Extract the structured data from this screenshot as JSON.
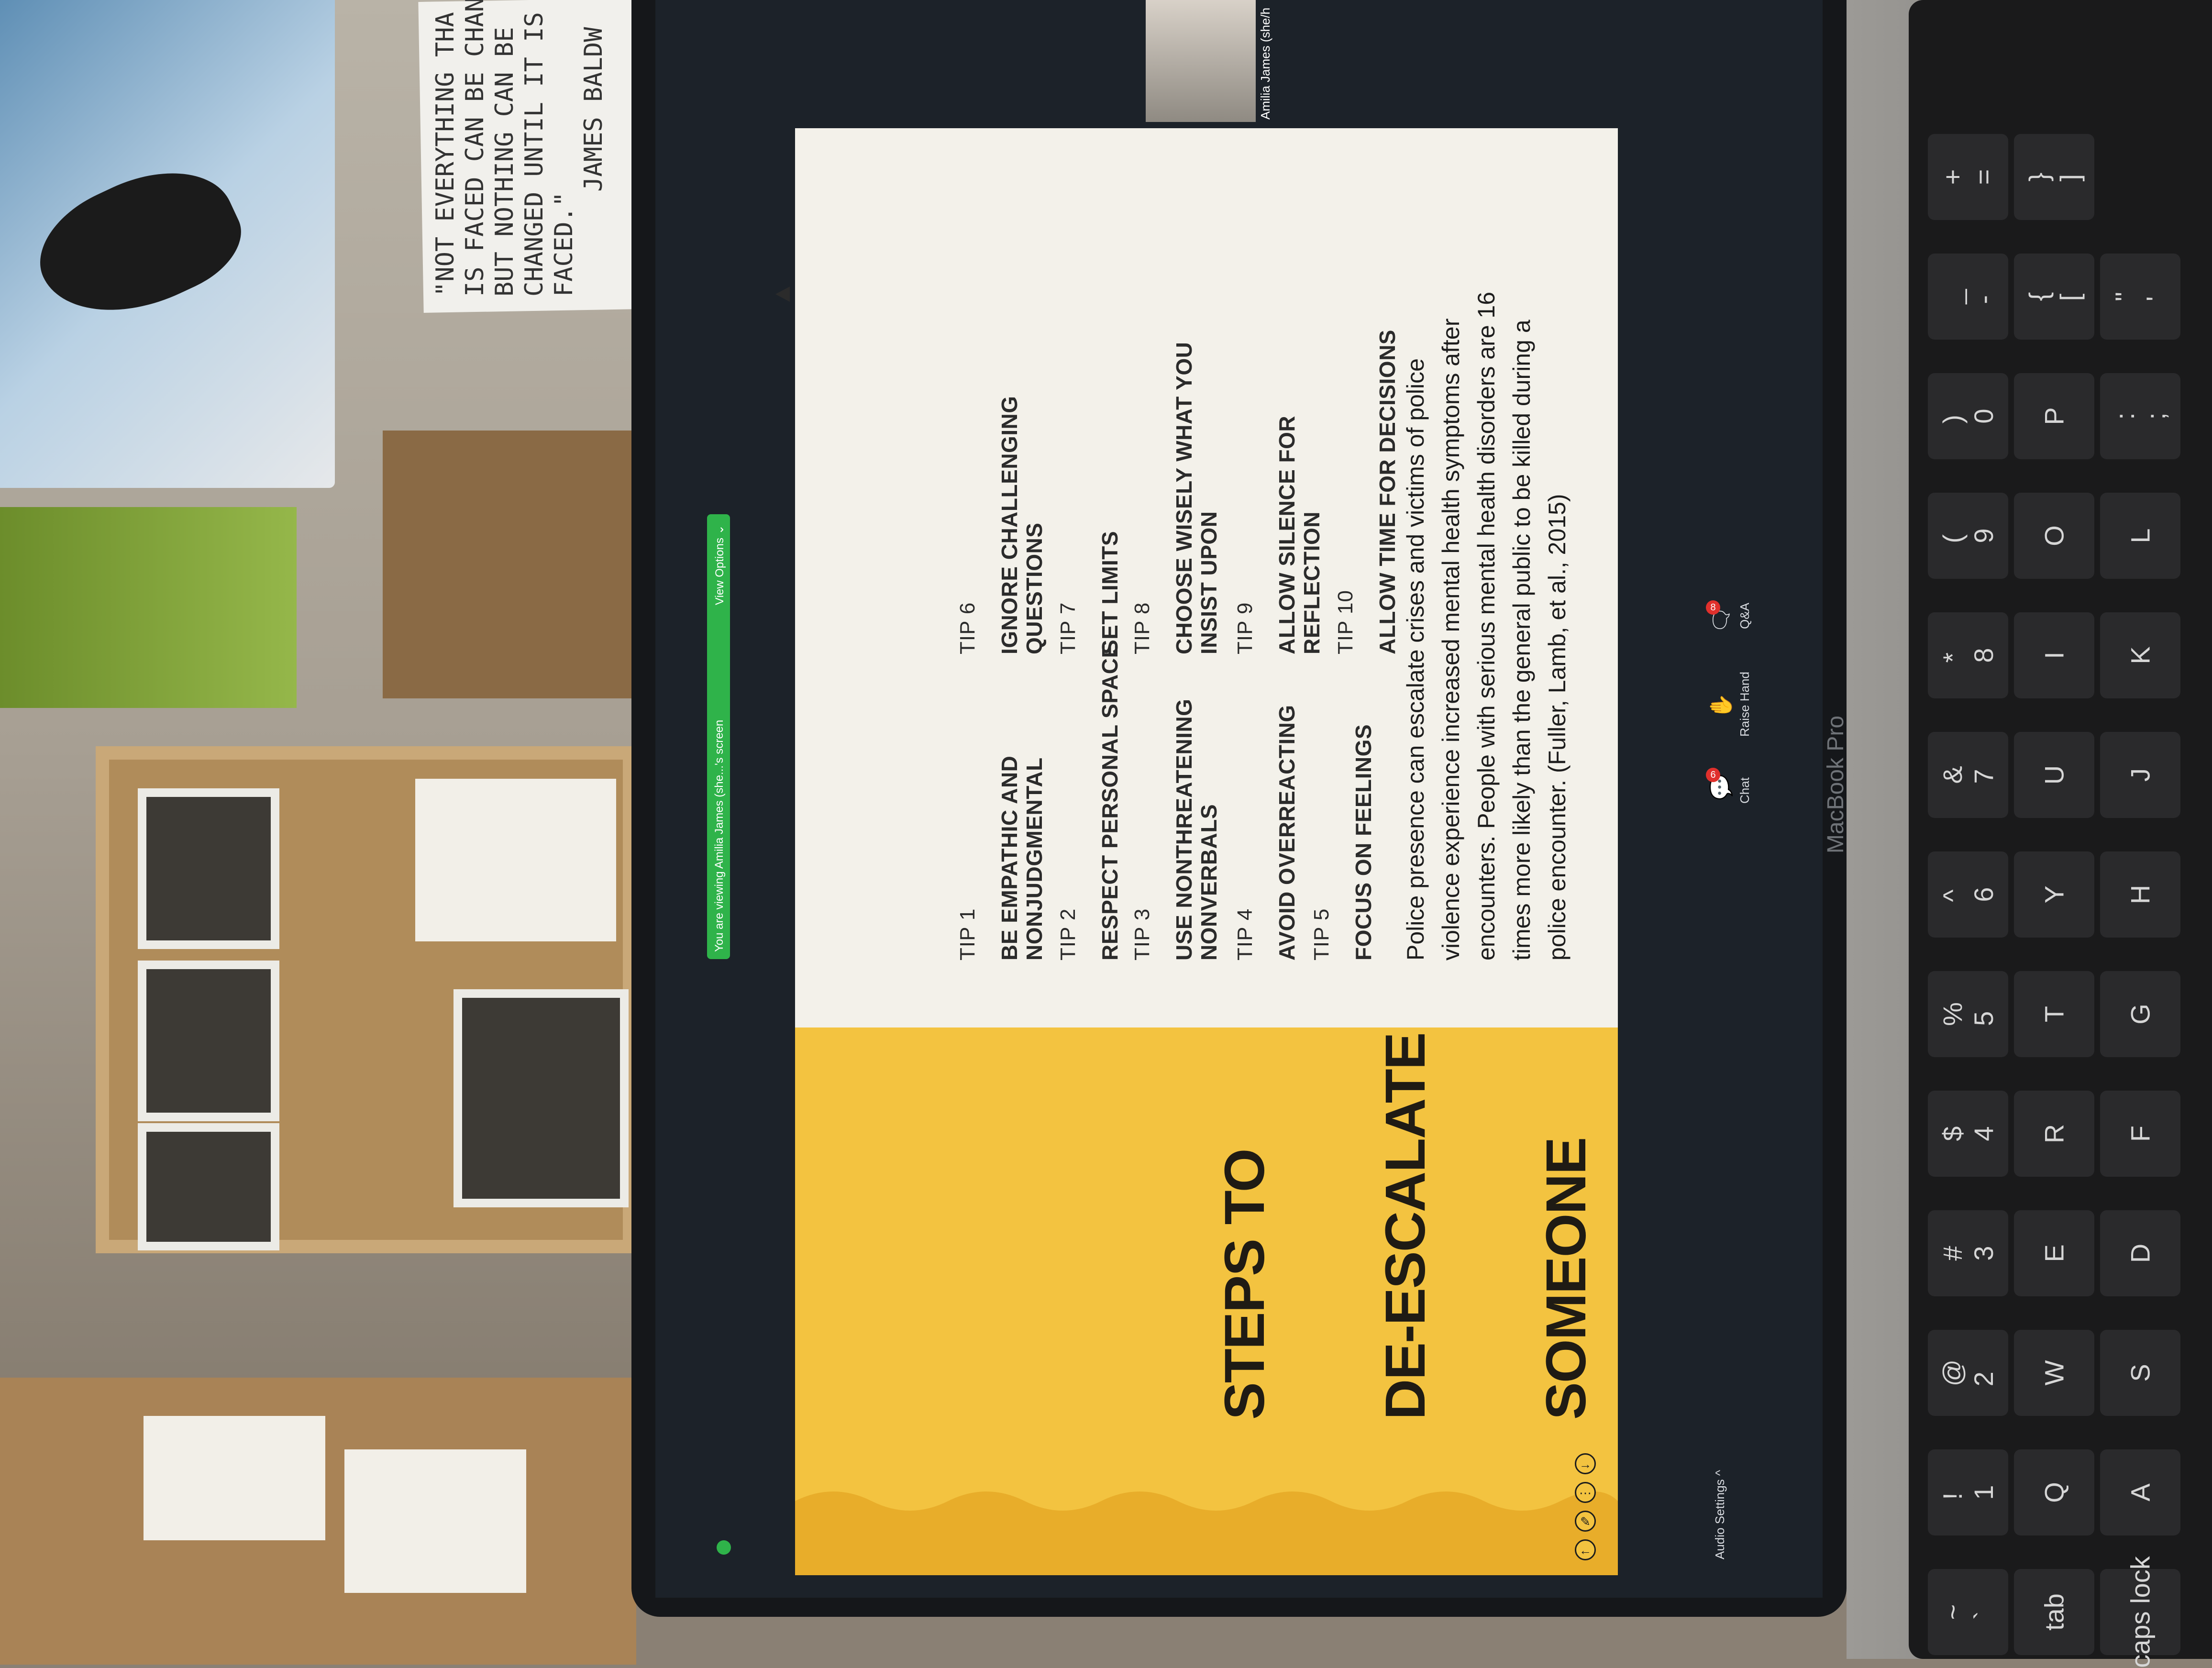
{
  "window": {
    "share_banner": "You are viewing Amilia James (she...'s screen",
    "view_options": "View Options ⌄",
    "participant_name": "Amilia James (she/h",
    "device_brand": "MacBook Pro"
  },
  "wall_note": {
    "text": "\"NOT EVERYTHING THA\nIS FACED CAN BE CHAN\nBUT NOTHING CAN BE\nCHANGED UNTIL IT IS\nFACED.\"\n       JAMES BALDW"
  },
  "slide": {
    "title_lines": [
      "STEPS TO",
      "DE-ESCALATE",
      "SOMEONE"
    ],
    "tips_left": [
      {
        "num": "TIP 1",
        "text": "BE EMPATHIC AND\nNONJUDGMENTAL"
      },
      {
        "num": "TIP 2",
        "text": "RESPECT PERSONAL SPACE"
      },
      {
        "num": "TIP 3",
        "text": "USE NONTHREATENING\nNONVERBALS"
      },
      {
        "num": "TIP 4",
        "text": "AVOID OVERREACTING"
      },
      {
        "num": "TIP 5",
        "text": "FOCUS ON FEELINGS"
      }
    ],
    "tips_right": [
      {
        "num": "TIP 6",
        "text": "IGNORE CHALLENGING\nQUESTIONS"
      },
      {
        "num": "TIP 7",
        "text": "SET LIMITS"
      },
      {
        "num": "TIP 8",
        "text": "CHOOSE WISELY WHAT YOU\nINSIST UPON"
      },
      {
        "num": "TIP 9",
        "text": "ALLOW SILENCE FOR\nREFLECTION"
      },
      {
        "num": "TIP 10",
        "text": "ALLOW TIME FOR DECISIONS"
      }
    ],
    "body": "Police presence can escalate crises and victims of police\nviolence experience increased mental health symptoms after\nencounters. People with serious mental health disorders are 16\ntimes more likely than the general public to be killed during a\npolice encounter. (Fuller, Lamb, et al., 2015)"
  },
  "controls": {
    "audio_settings": "Audio Settings ^",
    "chat": "Chat",
    "chat_badge": "6",
    "raise_hand": "Raise Hand",
    "qa": "Q&A",
    "qa_badge": "8"
  },
  "keyboard": {
    "row_numbers": [
      "~\n`",
      "!\n1",
      "@\n2",
      "#\n3",
      "$\n4",
      "%\n5",
      "^\n6",
      "&\n7",
      "*\n8",
      "(\n9",
      ")\n0",
      "_\n-",
      "+\n="
    ],
    "row_qwerty": [
      "tab",
      "Q",
      "W",
      "E",
      "R",
      "T",
      "Y",
      "U",
      "I",
      "O",
      "P",
      "{\n[",
      "}\n]"
    ],
    "row_home": [
      "caps lock",
      "A",
      "S",
      "D",
      "F",
      "G",
      "H",
      "J",
      "K",
      "L",
      ":\n;",
      "\"\n'"
    ]
  },
  "colors": {
    "slide_yellow": "#f3c340",
    "slide_white": "#f3f1ea",
    "share_green": "#2fb34a"
  }
}
